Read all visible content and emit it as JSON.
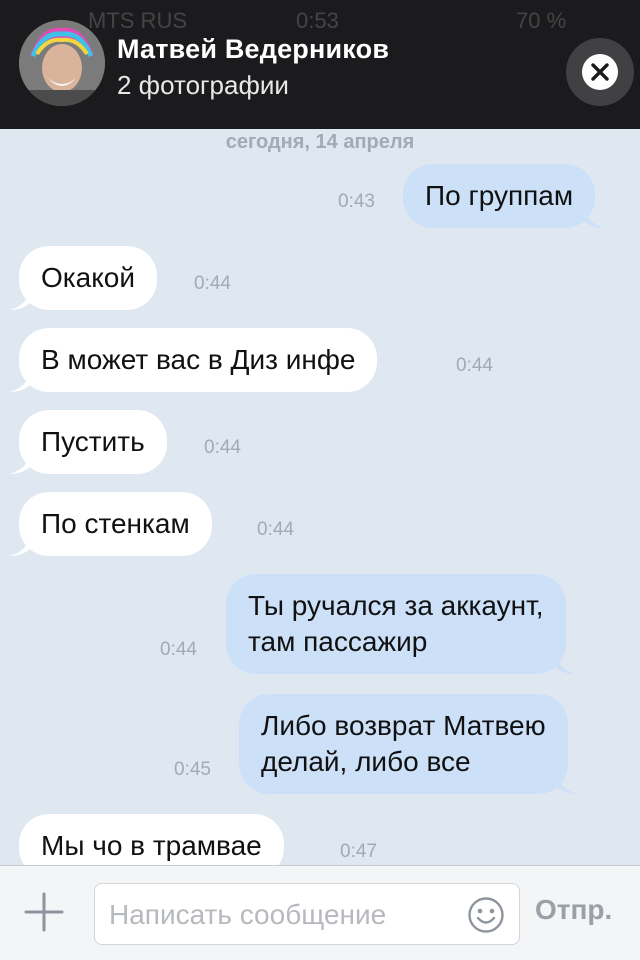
{
  "header": {
    "title": "Матвей Ведерников",
    "subtitle": "2 фотографии"
  },
  "status_ghost": {
    "carrier": "MTS RUS",
    "time": "0:53",
    "battery": "70 %"
  },
  "chat": {
    "date_separator": "сегодня, 14 апреля",
    "messages": [
      {
        "dir": "out",
        "text": "По группам",
        "time": "0:43"
      },
      {
        "dir": "in",
        "text": "Окакой",
        "time": "0:44"
      },
      {
        "dir": "in",
        "text": "В может вас в Диз инфе",
        "time": "0:44"
      },
      {
        "dir": "in",
        "text": "Пустить",
        "time": "0:44"
      },
      {
        "dir": "in",
        "text": "По стенкам",
        "time": "0:44"
      },
      {
        "dir": "out",
        "text1": "Ты ручался за аккаунт,",
        "text2": "там пассажир",
        "time": "0:44"
      },
      {
        "dir": "out",
        "text1": "Либо возврат Матвею",
        "text2": "делай, либо все",
        "time": "0:45"
      },
      {
        "dir": "in",
        "text": "Мы чо в трамвае",
        "time": "0:47"
      }
    ]
  },
  "input": {
    "placeholder": "Написать сообщение",
    "send_label": "Отпр."
  },
  "icons": {
    "close": "close-icon",
    "attach": "plus-icon",
    "emoji": "smiley-icon"
  },
  "colors": {
    "background": "#dfe7f1",
    "incoming_bubble": "#ffffff",
    "outgoing_bubble": "#cce0f8",
    "header_bg": "#1b1b1d"
  }
}
